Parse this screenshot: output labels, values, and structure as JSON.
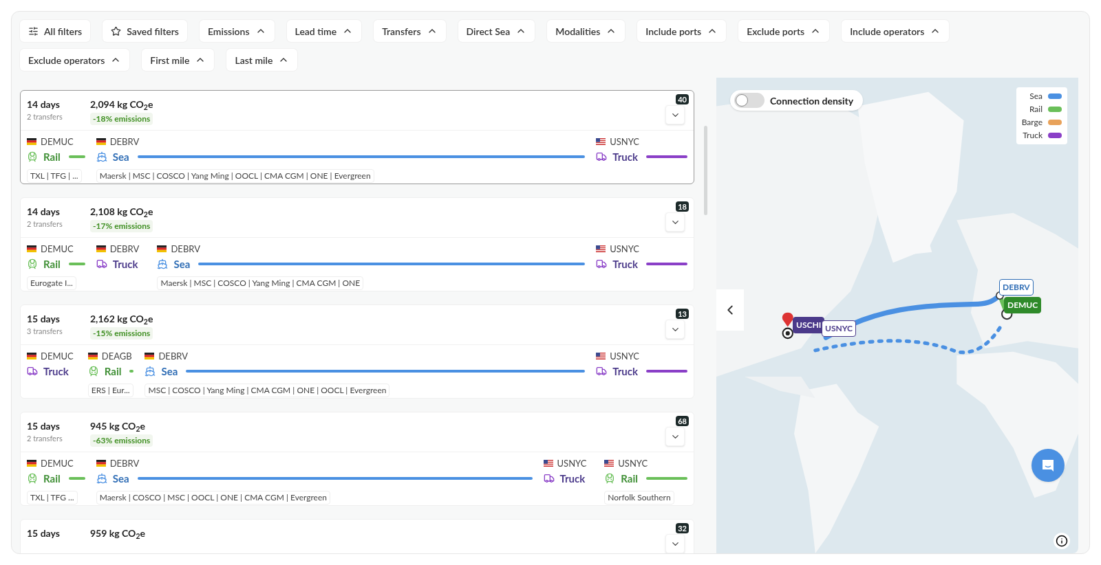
{
  "filters": [
    {
      "label": "All filters",
      "kind": "all"
    },
    {
      "label": "Saved filters",
      "kind": "saved"
    },
    {
      "label": "Emissions",
      "kind": "dropdown"
    },
    {
      "label": "Lead time",
      "kind": "dropdown"
    },
    {
      "label": "Transfers",
      "kind": "dropdown"
    },
    {
      "label": "Direct Sea",
      "kind": "dropdown"
    },
    {
      "label": "Modalities",
      "kind": "dropdown"
    },
    {
      "label": "Include ports",
      "kind": "dropdown"
    },
    {
      "label": "Exclude ports",
      "kind": "dropdown"
    },
    {
      "label": "Include operators",
      "kind": "dropdown"
    },
    {
      "label": "Exclude operators",
      "kind": "dropdown"
    },
    {
      "label": "First mile",
      "kind": "dropdown"
    },
    {
      "label": "Last mile",
      "kind": "dropdown"
    }
  ],
  "routes": [
    {
      "duration": "14 days",
      "transfers": "2 transfers",
      "emissions": "2,094 kg CO$_{2}$e",
      "change": "-18% emissions",
      "count": "40",
      "selected": true,
      "legs": [
        {
          "port": {
            "code": "DEMUC",
            "kind": "de"
          },
          "mode": {
            "label": "Rail",
            "kind": "rail"
          },
          "line": {
            "kind": "short"
          },
          "operators": "TXL | TFG | ..."
        },
        {
          "port": {
            "code": "DEBRV",
            "kind": "de"
          },
          "mode": {
            "label": "Sea",
            "kind": "sea"
          },
          "line": {
            "kind": "long"
          },
          "operators": "Maersk | MSC | COSCO | Yang Ming | OOCL | CMA CGM | ONE | Evergreen"
        },
        {
          "port": {
            "code": "USNYC",
            "kind": "us"
          },
          "mode": {
            "label": "Truck",
            "kind": "truck"
          },
          "line": {
            "kind": "medium"
          }
        }
      ]
    },
    {
      "duration": "14 days",
      "transfers": "2 transfers",
      "emissions": "2,108 kg CO$_{2}$e",
      "change": "-17% emissions",
      "count": "18",
      "selected": false,
      "legs": [
        {
          "port": {
            "code": "DEMUC",
            "kind": "de"
          },
          "mode": {
            "label": "Rail",
            "kind": "rail"
          },
          "line": {
            "kind": "short"
          },
          "operators": "Eurogate I..."
        },
        {
          "port": {
            "code": "DEBRV",
            "kind": "de"
          },
          "mode": {
            "label": "Truck",
            "kind": "truck"
          }
        },
        {
          "port": {
            "code": "DEBRV",
            "kind": "de"
          },
          "mode": {
            "label": "Sea",
            "kind": "sea"
          },
          "line": {
            "kind": "long"
          },
          "operators": "Maersk | MSC | COSCO | Yang Ming | CMA CGM | ONE"
        },
        {
          "port": {
            "code": "USNYC",
            "kind": "us"
          },
          "mode": {
            "label": "Truck",
            "kind": "truck"
          },
          "line": {
            "kind": "medium"
          }
        }
      ]
    },
    {
      "duration": "15 days",
      "transfers": "3 transfers",
      "emissions": "2,162 kg CO$_{2}$e",
      "change": "-15% emissions",
      "count": "13",
      "selected": false,
      "legs": [
        {
          "port": {
            "code": "DEMUC",
            "kind": "de"
          },
          "mode": {
            "label": "Truck",
            "kind": "truck"
          }
        },
        {
          "port": {
            "code": "DEAGB",
            "kind": "de"
          },
          "mode": {
            "label": "Rail",
            "kind": "rail"
          },
          "line": {
            "kind": "tiny"
          },
          "operators": "ERS | Eur..."
        },
        {
          "port": {
            "code": "DEBRV",
            "kind": "de"
          },
          "mode": {
            "label": "Sea",
            "kind": "sea"
          },
          "line": {
            "kind": "long"
          },
          "operators": "MSC | COSCO | Yang Ming | CMA CGM | ONE | OOCL | Evergreen"
        },
        {
          "port": {
            "code": "USNYC",
            "kind": "us"
          },
          "mode": {
            "label": "Truck",
            "kind": "truck"
          },
          "line": {
            "kind": "medium"
          }
        }
      ]
    },
    {
      "duration": "15 days",
      "transfers": "2 transfers",
      "emissions": "945 kg CO$_{2}$e",
      "change": "-63% emissions",
      "count": "68",
      "selected": false,
      "legs": [
        {
          "port": {
            "code": "DEMUC",
            "kind": "de"
          },
          "mode": {
            "label": "Rail",
            "kind": "rail"
          },
          "line": {
            "kind": "short"
          },
          "operators": "TXL | TFG ..."
        },
        {
          "port": {
            "code": "DEBRV",
            "kind": "de"
          },
          "mode": {
            "label": "Sea",
            "kind": "sea"
          },
          "line": {
            "kind": "long"
          },
          "operators": "Maersk | COSCO | MSC | OOCL | ONE | CMA CGM | Evergreen"
        },
        {
          "port": {
            "code": "USNYC",
            "kind": "us"
          },
          "mode": {
            "label": "Truck",
            "kind": "truck"
          }
        },
        {
          "port": {
            "code": "USNYC",
            "kind": "us"
          },
          "mode": {
            "label": "Rail",
            "kind": "rail"
          },
          "line": {
            "kind": "medium"
          },
          "operators": "Norfolk Southern"
        }
      ]
    },
    {
      "duration": "15 days",
      "emissions": "959 kg CO$_{2}$e",
      "count": "32",
      "selected": false
    }
  ],
  "map": {
    "toggle": {
      "label": "Connection density",
      "on": false
    },
    "legend": [
      {
        "label": "Sea",
        "color": "#4a90e2"
      },
      {
        "label": "Rail",
        "color": "#6abf59"
      },
      {
        "label": "Barge",
        "color": "#e8a25a"
      },
      {
        "label": "Truck",
        "color": "#8a3fc7"
      }
    ],
    "markers": [
      {
        "label": "DEBRV",
        "color": "#2f6db5",
        "filled": false
      },
      {
        "label": "DEMUC",
        "color": "#2f8a2a",
        "filled": true
      },
      {
        "label": "USCHI",
        "color": "#4b3a8a",
        "filled": true
      },
      {
        "label": "USNYC",
        "color": "#4b3a8a",
        "filled": false
      }
    ]
  }
}
